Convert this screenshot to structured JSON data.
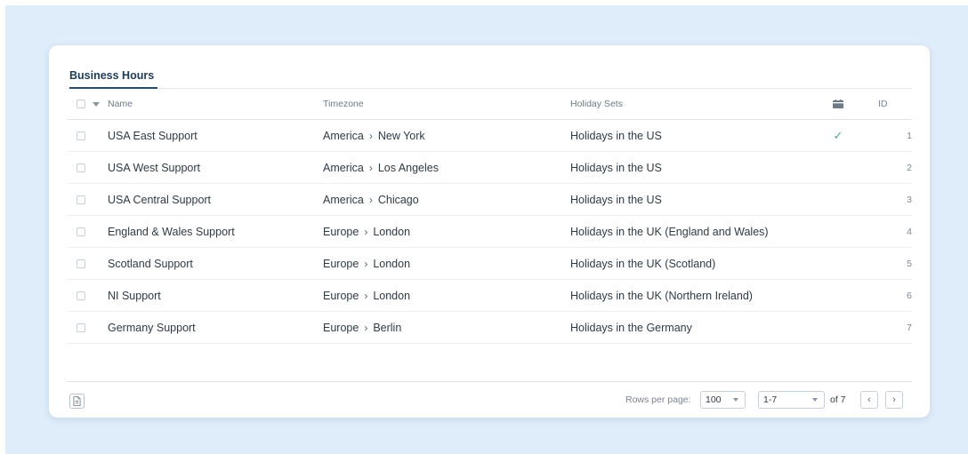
{
  "tabs": [
    {
      "label": "Business Hours"
    }
  ],
  "table": {
    "headers": {
      "name": "Name",
      "timezone": "Timezone",
      "holiday_sets": "Holiday Sets",
      "calendar_icon": "calendar-icon",
      "id": "ID"
    },
    "rows": [
      {
        "name": "USA East Support",
        "tz_region": "America",
        "tz_city": "New York",
        "holiday_set": "Holidays in the US",
        "calendar_checked": true,
        "id": "1"
      },
      {
        "name": "USA West Support",
        "tz_region": "America",
        "tz_city": "Los Angeles",
        "holiday_set": "Holidays in the US",
        "calendar_checked": false,
        "id": "2"
      },
      {
        "name": "USA Central Support",
        "tz_region": "America",
        "tz_city": "Chicago",
        "holiday_set": "Holidays in the US",
        "calendar_checked": false,
        "id": "3"
      },
      {
        "name": "England & Wales Support",
        "tz_region": "Europe",
        "tz_city": "London",
        "holiday_set": "Holidays in the UK (England and Wales)",
        "calendar_checked": false,
        "id": "4"
      },
      {
        "name": "Scotland Support",
        "tz_region": "Europe",
        "tz_city": "London",
        "holiday_set": "Holidays in the UK (Scotland)",
        "calendar_checked": false,
        "id": "5"
      },
      {
        "name": "NI Support",
        "tz_region": "Europe",
        "tz_city": "London",
        "holiday_set": "Holidays in the UK (Northern Ireland)",
        "calendar_checked": false,
        "id": "6"
      },
      {
        "name": "Germany Support",
        "tz_region": "Europe",
        "tz_city": "Berlin",
        "holiday_set": "Holidays in the Germany",
        "calendar_checked": false,
        "id": "7"
      }
    ]
  },
  "footer": {
    "rows_per_page_label": "Rows per page:",
    "rows_per_page_value": "100",
    "range_value": "1-7",
    "of_label": "of 7",
    "prev_glyph": "‹",
    "next_glyph": "›"
  },
  "colors": {
    "background": "#dfecfa",
    "accent": "#2b4a66",
    "check": "#3fae8c"
  }
}
